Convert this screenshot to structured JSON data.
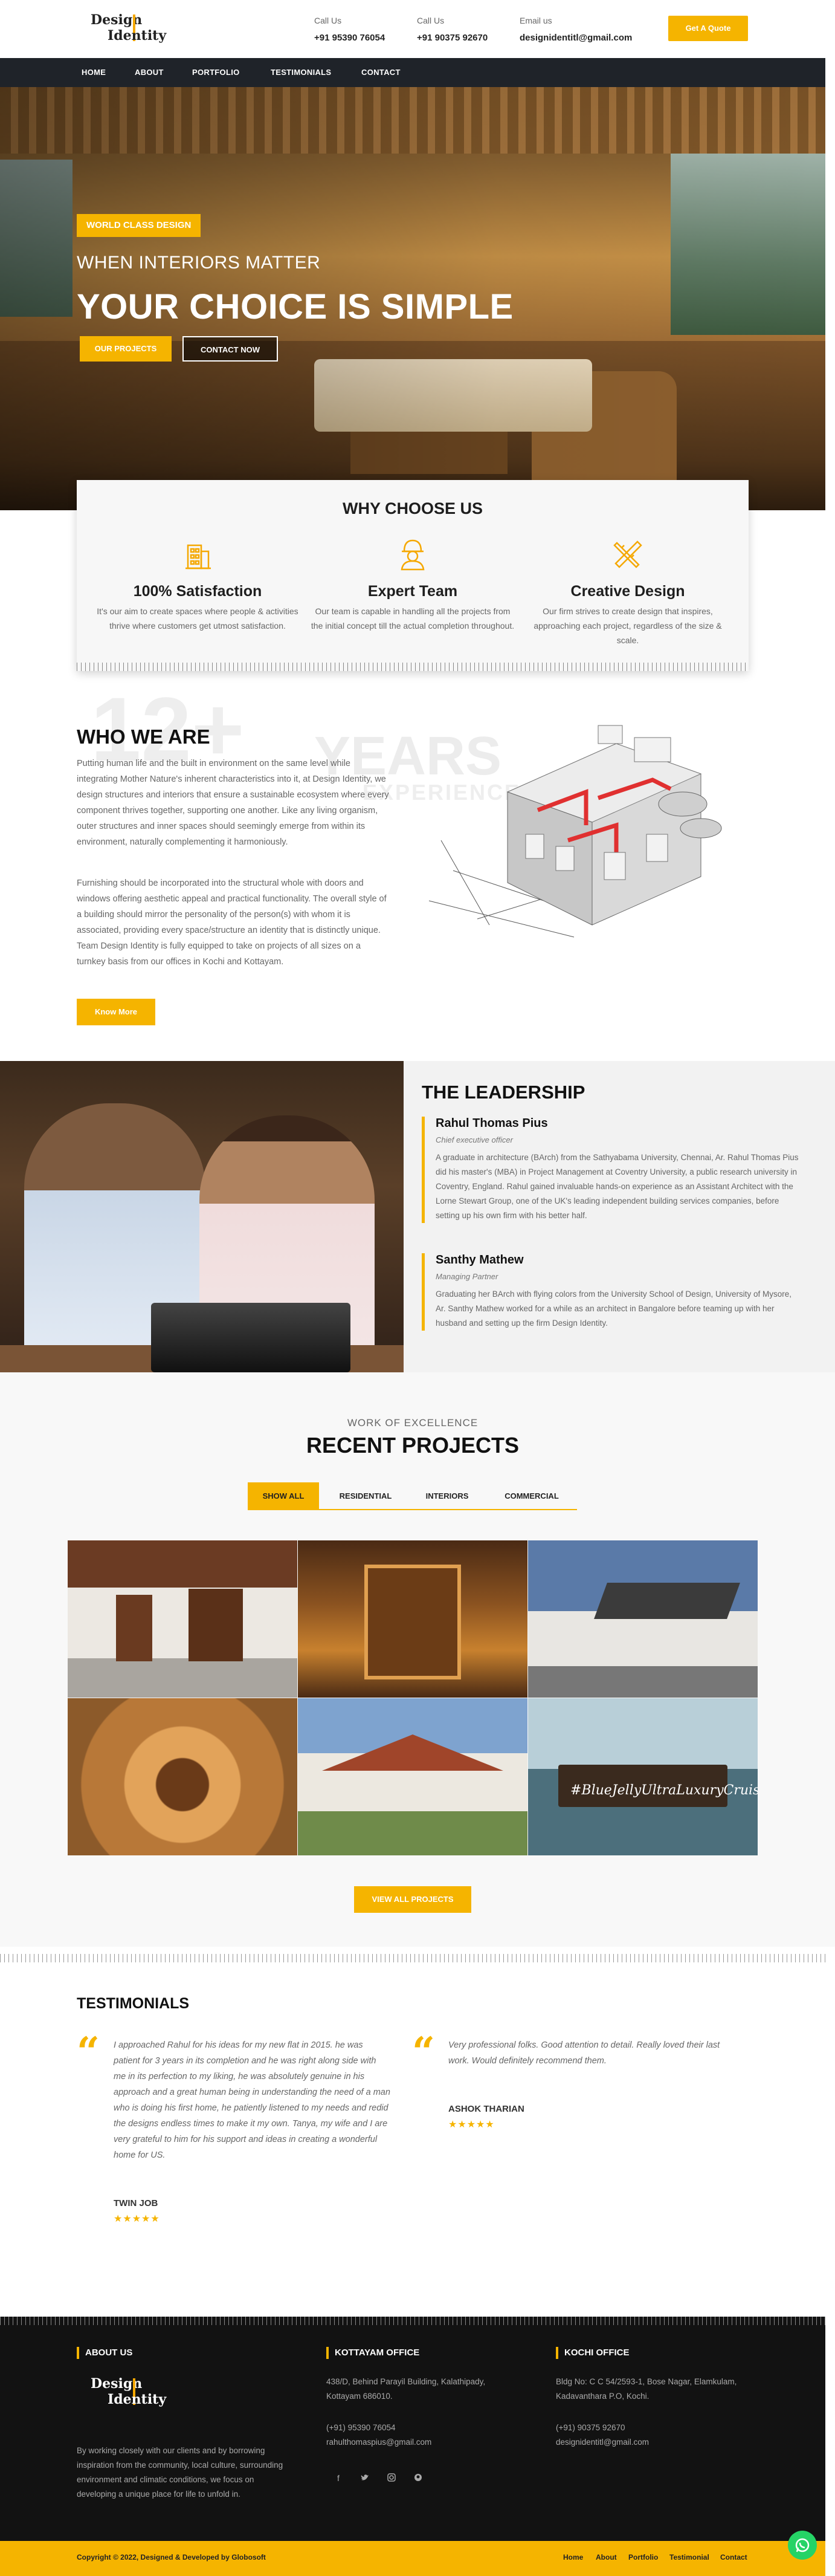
{
  "header": {
    "logo_line1": "Design",
    "logo_line2": "Identity",
    "call1_label": "Call Us",
    "call1_value": "+91 95390 76054",
    "call2_label": "Call Us",
    "call2_value": "+91 90375 92670",
    "email_label": "Email us",
    "email_value": "designidentitl@gmail.com",
    "quote_button": "Get A Quote"
  },
  "nav": [
    "HOME",
    "ABOUT",
    "PORTFOLIO",
    "TESTIMONIALS",
    "CONTACT"
  ],
  "hero": {
    "tag": "WORLD CLASS DESIGN",
    "subtitle": "WHEN INTERIORS MATTER",
    "title": "YOUR CHOICE IS SIMPLE",
    "btn_projects": "OUR PROJECTS",
    "btn_contact": "CONTACT NOW"
  },
  "why": {
    "title": "WHY CHOOSE US",
    "features": [
      {
        "icon": "building-icon",
        "title": "100% Satisfaction",
        "text": "It's our aim to create spaces where people & activities thrive where customers get utmost satisfaction."
      },
      {
        "icon": "engineer-icon",
        "title": "Expert Team",
        "text": "Our team is capable in handling all the projects from the initial concept till the actual completion throughout."
      },
      {
        "icon": "pencil-ruler-icon",
        "title": "Creative Design",
        "text": "Our firm strives to create design that inspires, approaching each project, regardless of the size & scale."
      }
    ]
  },
  "who": {
    "bg_number": "12+",
    "bg_years": "YEARS",
    "bg_experience": "EXPERIENCE",
    "title": "WHO WE ARE",
    "para1": "Putting human life and the built in environment on the same level while integrating Mother Nature's inherent characteristics into it, at Design Identity, we design structures and interiors that ensure a sustainable ecosystem where every component thrives together, supporting one another. Like any living organism, outer structures and inner spaces should seemingly emerge from within its environment, naturally complementing it harmoniously.",
    "para2": "Furnishing should be incorporated into the structural whole with doors and windows offering aesthetic appeal and practical functionality. The overall style of a building should mirror the personality of the person(s) with whom it is associated, providing every space/structure an identity that is distinctly unique. Team Design Identity is fully equipped to take on projects of all sizes on a turnkey basis from our offices in Kochi and Kottayam.",
    "button": "Know More"
  },
  "leadership": {
    "title": "THE LEADERSHIP",
    "people": [
      {
        "name": "Rahul Thomas Pius",
        "role": "Chief executive officer",
        "bio": "A graduate in architecture (BArch) from the Sathyabama University, Chennai, Ar. Rahul Thomas Pius did his master's (MBA) in Project Management at Coventry University, a public research university in Coventry, England. Rahul gained invaluable hands-on experience as an Assistant Architect with the Lorne Stewart Group, one of the UK's leading independent building services companies, before setting up his own firm with his better half."
      },
      {
        "name": "Santhy Mathew",
        "role": "Managing Partner",
        "bio": "Graduating her BArch with flying colors from the University School of Design, University of Mysore, Ar. Santhy Mathew worked for a while as an architect in Bangalore before teaming up with her husband and setting up the firm Design Identity."
      }
    ]
  },
  "projects": {
    "kicker": "WORK OF EXCELLENCE",
    "title": "RECENT PROJECTS",
    "tabs": [
      "SHOW ALL",
      "RESIDENTIAL",
      "INTERIORS",
      "COMMERCIAL"
    ],
    "boat_caption": "#BlueJellyUltraLuxuryCruise",
    "button": "VIEW ALL PROJECTS"
  },
  "testimonials": {
    "title": "TESTIMONIALS",
    "items": [
      {
        "text": "I approached Rahul for his ideas for my new flat in 2015. he was patient for 3 years in its completion and he was right along side with me in its perfection to my liking, he was absolutely genuine in his approach and a great human being in understanding the need of a man who is doing his first home, he patiently listened to my needs and redid the designs endless times to make it my own. Tanya, my wife and I are very grateful to him for his support and ideas in creating a wonderful home for US.",
        "name": "TWIN JOB",
        "stars": "★★★★★"
      },
      {
        "text": "Very professional folks. Good attention to detail. Really loved their last work. Would definitely recommend them.",
        "name": "ASHOK THARIAN",
        "stars": "★★★★★"
      }
    ]
  },
  "footer": {
    "about_title": "ABOUT US",
    "about_text": "By working closely with our clients and by borrowing inspiration from the community, local culture, surrounding environment and climatic conditions, we focus on developing a unique place for life to unfold in.",
    "kottayam_title": "KOTTAYAM OFFICE",
    "kottayam_address": "438/D, Behind Parayil Building, Kalathipady, Kottayam 686010.",
    "kottayam_phone": "(+91) 95390 76054",
    "kottayam_email": "rahulthomaspius@gmail.com",
    "kochi_title": "KOCHI OFFICE",
    "kochi_address": "Bldg No: C C 54/2593-1, Bose Nagar, Elamkulam, Kadavanthara P.O, Kochi.",
    "kochi_phone": "(+91) 90375 92670",
    "kochi_email": "designidentitl@gmail.com",
    "copyright": "Copyright © 2022, Designed & Developed by Globosoft",
    "links": [
      "Home",
      "About",
      "Portfolio",
      "Testimonial",
      "Contact"
    ]
  },
  "colors": {
    "accent": "#f5b400",
    "nav": "#1f2329",
    "footer": "#121212"
  }
}
